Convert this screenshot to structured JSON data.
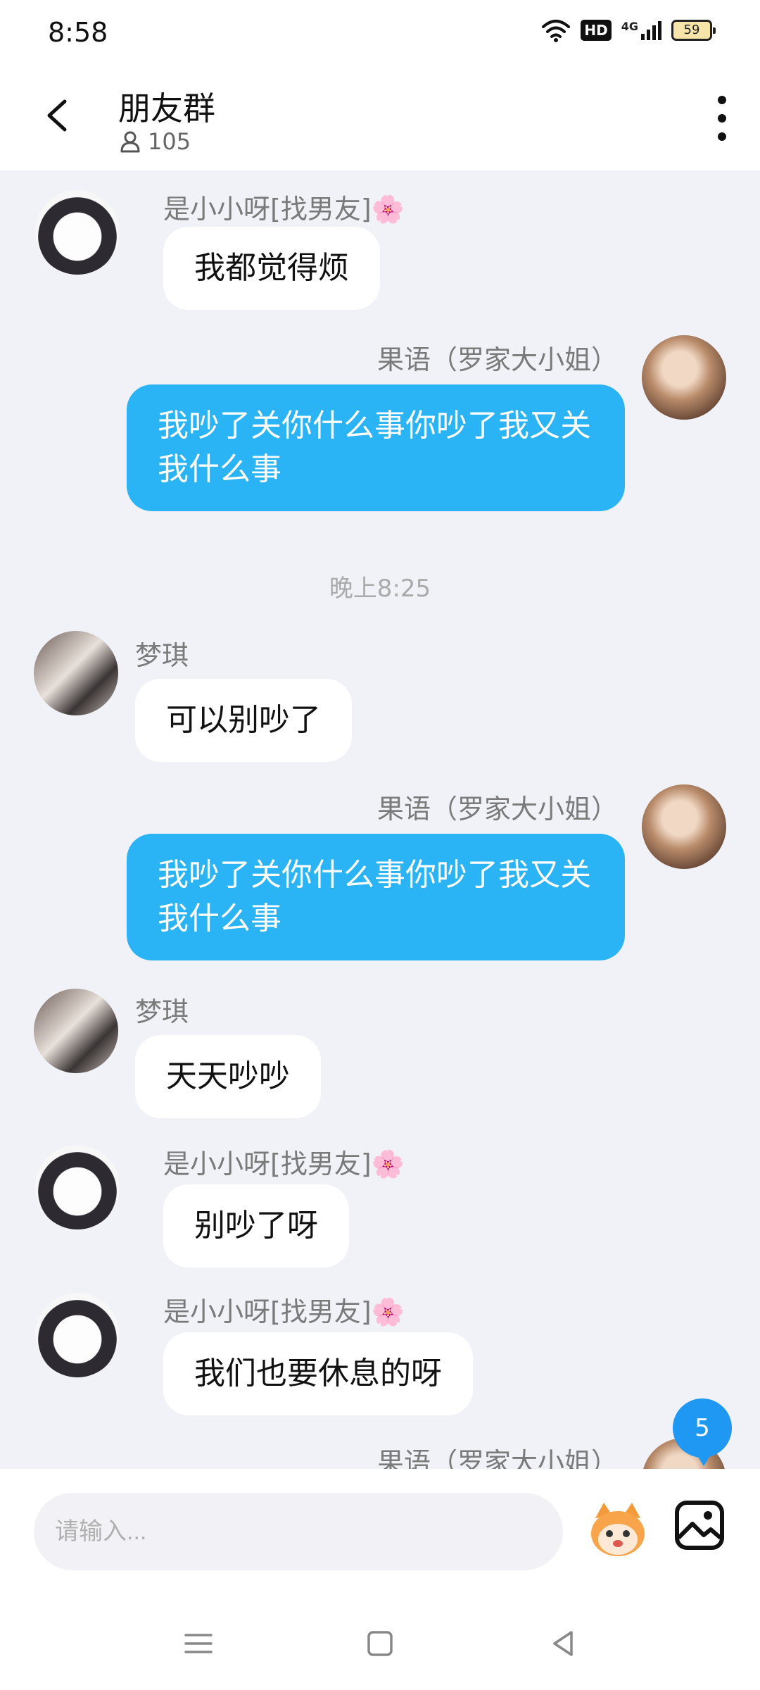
{
  "status_bar": {
    "time": "8:58",
    "hd": "HD",
    "network": "4G",
    "battery": "59"
  },
  "header": {
    "title": "朋友群",
    "member_count": "105"
  },
  "messages": [
    {
      "nick": "是小小呀[找男友]🌸",
      "text": "我都觉得烦"
    },
    {
      "nick": "果语（罗家大小姐）",
      "text": "我吵了关你什么事你吵了我又关我什么事"
    },
    {
      "time": "晚上8:25"
    },
    {
      "nick": "梦琪",
      "text": "可以别吵了"
    },
    {
      "nick": "果语（罗家大小姐）",
      "text": "我吵了关你什么事你吵了我又关我什么事"
    },
    {
      "nick": "梦琪",
      "text": "天天吵吵"
    },
    {
      "nick": "是小小呀[找男友]🌸",
      "text": "别吵了呀"
    },
    {
      "nick": "是小小呀[找男友]🌸",
      "text": "我们也要休息的呀"
    },
    {
      "nick": "果语（罗家大小姐）"
    }
  ],
  "unread_badge": "5",
  "input": {
    "placeholder": "请输入..."
  },
  "colors": {
    "outgoing_bubble": "#2ab4f6",
    "incoming_bubble": "#ffffff",
    "background": "#f1f2f8",
    "badge": "#1f98f3"
  },
  "icons": {
    "back": "back-arrow-icon",
    "more": "more-vertical-icon",
    "member": "person-icon",
    "emoji": "emoji-mascot-icon",
    "image": "image-icon",
    "nav": [
      "menu-icon",
      "home-square-icon",
      "back-triangle-icon"
    ]
  }
}
